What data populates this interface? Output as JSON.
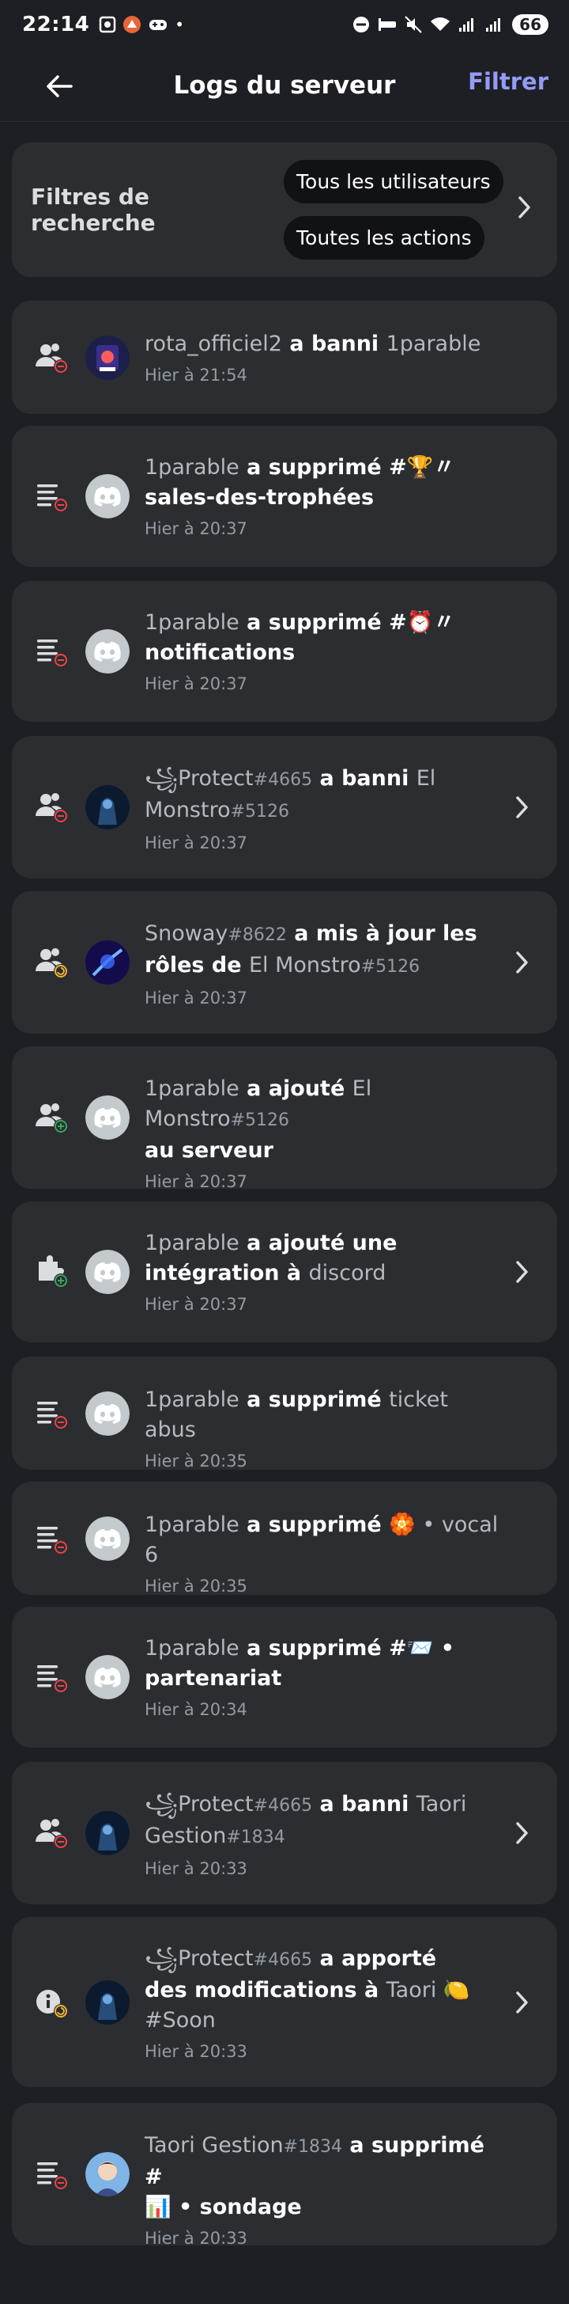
{
  "status_bar": {
    "time": "22:14",
    "battery": "66",
    "dot": "•"
  },
  "header": {
    "title": "Logs du serveur",
    "filter_label": "Filtrer"
  },
  "filters": {
    "label": "Filtres de recherche",
    "user_chip": "Tous les utilisateurs",
    "action_chip": "Toutes les actions"
  },
  "colors": {
    "accent": "#949cf7",
    "background": "#1e1f24",
    "card": "#2b2d31",
    "danger_badge": "#ed4245",
    "success_badge": "#3ba55c",
    "update_badge": "#f0b232",
    "discord_avatar": "#c4c9ce"
  },
  "logs": [
    {
      "line1": [
        {
          "t": "rota_officiel2",
          "s": "n"
        },
        {
          "t": " a banni ",
          "s": "b"
        },
        {
          "t": "1parable",
          "s": "n"
        }
      ],
      "line2": [],
      "time": "Hier à 21:54",
      "icon": "ban-user-icon",
      "badge": "danger",
      "avatar": "game-avatar",
      "chevron": false
    },
    {
      "line1": [
        {
          "t": "1parable",
          "s": "n"
        },
        {
          "t": " a supprimé #🏆〃",
          "s": "b"
        }
      ],
      "line2": [
        {
          "t": "sales-des-trophées",
          "s": "b"
        }
      ],
      "time": "Hier à 20:37",
      "icon": "channel-icon",
      "badge": "danger",
      "avatar": "discord-avatar",
      "chevron": false
    },
    {
      "line1": [
        {
          "t": "1parable",
          "s": "n"
        },
        {
          "t": " a supprimé #⏰〃",
          "s": "b"
        }
      ],
      "line2": [
        {
          "t": "notifications",
          "s": "b"
        }
      ],
      "time": "Hier à 20:37",
      "icon": "channel-icon",
      "badge": "danger",
      "avatar": "discord-avatar",
      "chevron": false
    },
    {
      "line1": [
        {
          "t": "꧁Protect",
          "s": "n"
        },
        {
          "t": "#4665",
          "s": "t"
        },
        {
          "t": " a banni ",
          "s": "b"
        },
        {
          "t": "El",
          "s": "n"
        }
      ],
      "line2": [
        {
          "t": "Monstro",
          "s": "n"
        },
        {
          "t": "#5126",
          "s": "t"
        }
      ],
      "time": "Hier à 20:37",
      "icon": "ban-user-icon",
      "badge": "danger",
      "avatar": "protect-avatar",
      "chevron": true
    },
    {
      "line1": [
        {
          "t": "Snoway",
          "s": "n"
        },
        {
          "t": "#8622",
          "s": "t"
        },
        {
          "t": " a mis à jour les",
          "s": "b"
        }
      ],
      "line2": [
        {
          "t": "rôles de ",
          "s": "b"
        },
        {
          "t": "El Monstro",
          "s": "n"
        },
        {
          "t": "#5126",
          "s": "t"
        }
      ],
      "time": "Hier à 20:37",
      "icon": "member-role-icon",
      "badge": "update",
      "avatar": "snoway-avatar",
      "chevron": true
    },
    {
      "line1": [
        {
          "t": "1parable",
          "s": "n"
        },
        {
          "t": " a ajouté ",
          "s": "b"
        },
        {
          "t": "El Monstro",
          "s": "n"
        },
        {
          "t": "#5126",
          "s": "t"
        }
      ],
      "line2": [
        {
          "t": "au serveur",
          "s": "b"
        }
      ],
      "time": "Hier à 20:37",
      "icon": "add-member-icon",
      "badge": "success",
      "avatar": "discord-avatar",
      "chevron": false
    },
    {
      "line1": [
        {
          "t": "1parable",
          "s": "n"
        },
        {
          "t": " a ajouté une",
          "s": "b"
        }
      ],
      "line2": [
        {
          "t": "intégration à ",
          "s": "b"
        },
        {
          "t": "discord",
          "s": "n"
        }
      ],
      "time": "Hier à 20:37",
      "icon": "integration-icon",
      "badge": "success",
      "avatar": "discord-avatar",
      "chevron": true
    },
    {
      "line1": [
        {
          "t": "1parable",
          "s": "n"
        },
        {
          "t": " a supprimé ",
          "s": "b"
        },
        {
          "t": "ticket abus",
          "s": "n"
        }
      ],
      "line2": [],
      "time": "Hier à 20:35",
      "icon": "channel-icon",
      "badge": "danger",
      "avatar": "discord-avatar",
      "chevron": false
    },
    {
      "line1": [
        {
          "t": "1parable",
          "s": "n"
        },
        {
          "t": " a supprimé ",
          "s": "b"
        },
        {
          "t": "🏵️ • vocal 6",
          "s": "n"
        }
      ],
      "line2": [],
      "time": "Hier à 20:35",
      "icon": "channel-icon",
      "badge": "danger",
      "avatar": "discord-avatar",
      "chevron": false
    },
    {
      "line1": [
        {
          "t": "1parable",
          "s": "n"
        },
        {
          "t": " a supprimé #📨 •",
          "s": "b"
        }
      ],
      "line2": [
        {
          "t": "partenariat",
          "s": "b"
        }
      ],
      "time": "Hier à 20:34",
      "icon": "channel-icon",
      "badge": "danger",
      "avatar": "discord-avatar",
      "chevron": false
    },
    {
      "line1": [
        {
          "t": "꧁Protect",
          "s": "n"
        },
        {
          "t": "#4665",
          "s": "t"
        },
        {
          "t": " a banni ",
          "s": "b"
        },
        {
          "t": "Taori",
          "s": "n"
        }
      ],
      "line2": [
        {
          "t": "Gestion",
          "s": "n"
        },
        {
          "t": "#1834",
          "s": "t"
        }
      ],
      "time": "Hier à 20:33",
      "icon": "ban-user-icon",
      "badge": "danger",
      "avatar": "protect-avatar",
      "chevron": true
    },
    {
      "line1": [
        {
          "t": "꧁Protect",
          "s": "n"
        },
        {
          "t": "#4665",
          "s": "t"
        },
        {
          "t": " a apporté",
          "s": "b"
        }
      ],
      "line2": [
        {
          "t": "des modifications à ",
          "s": "b"
        },
        {
          "t": "Taori 🍋",
          "s": "n"
        }
      ],
      "line3": [
        {
          "t": "#Soon",
          "s": "n"
        }
      ],
      "time": "Hier à 20:33",
      "icon": "server-settings-icon",
      "badge": "update",
      "avatar": "protect-avatar",
      "chevron": true
    },
    {
      "line1": [
        {
          "t": "Taori Gestion",
          "s": "n"
        },
        {
          "t": "#1834",
          "s": "t"
        },
        {
          "t": " a supprimé #",
          "s": "b"
        }
      ],
      "line2": [
        {
          "t": "📊 • sondage",
          "s": "b"
        }
      ],
      "time": "Hier à 20:33",
      "icon": "channel-icon",
      "badge": "danger",
      "avatar": "taori-avatar",
      "chevron": false
    }
  ]
}
